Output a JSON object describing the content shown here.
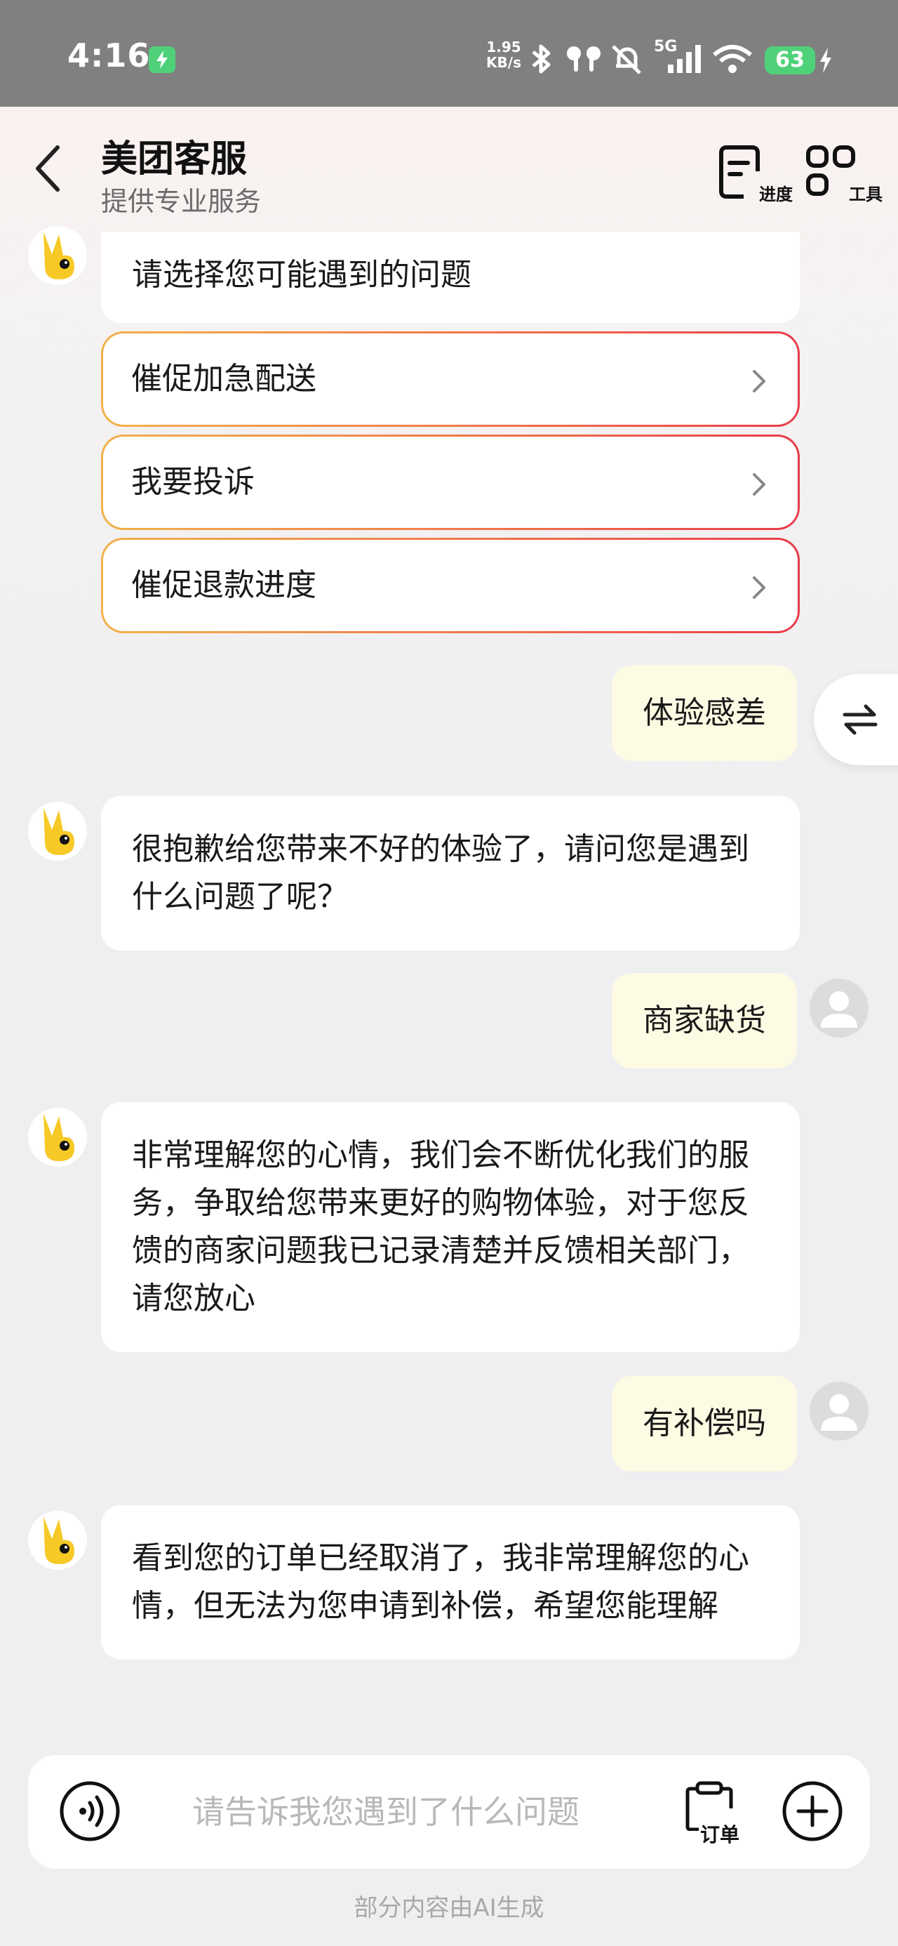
{
  "status_bar": {
    "time": "4:16",
    "net_speed_value": "1.95",
    "net_speed_unit": "KB/s",
    "network": "5G",
    "battery": "63",
    "colors": {
      "bar": "#808080",
      "battery": "#4fd17a"
    }
  },
  "header": {
    "title": "美团客服",
    "subtitle": "提供专业服务",
    "progress_label": "进度",
    "tools_label": "工具"
  },
  "messages": {
    "bot_prompt": "请选择您可能遇到的问题",
    "options": [
      {
        "label": "催促加急配送"
      },
      {
        "label": "我要投诉"
      },
      {
        "label": "催促退款进度"
      }
    ],
    "user_1": "体验感差",
    "bot_1": "很抱歉给您带来不好的体验了，请问您是遇到什么问题了呢？",
    "user_2": "商家缺货",
    "bot_2": "非常理解您的心情，我们会不断优化我们的服务，争取给您带来更好的购物体验，对于您反馈的商家问题我已记录清楚并反馈相关部门，请您放心",
    "user_3": "有补偿吗",
    "bot_3": "看到您的订单已经取消了，我非常理解您的心情，但无法为您申请到补偿，希望您能理解"
  },
  "input": {
    "placeholder": "请告诉我您遇到了什么问题",
    "order_label": "订单"
  },
  "footer_note": "部分内容由AI生成",
  "colors": {
    "user_bubble": "#fdfbe3",
    "option_border_start": "#f2b24b",
    "option_border_end": "#e83d4a",
    "mascot": "#f6c927"
  }
}
